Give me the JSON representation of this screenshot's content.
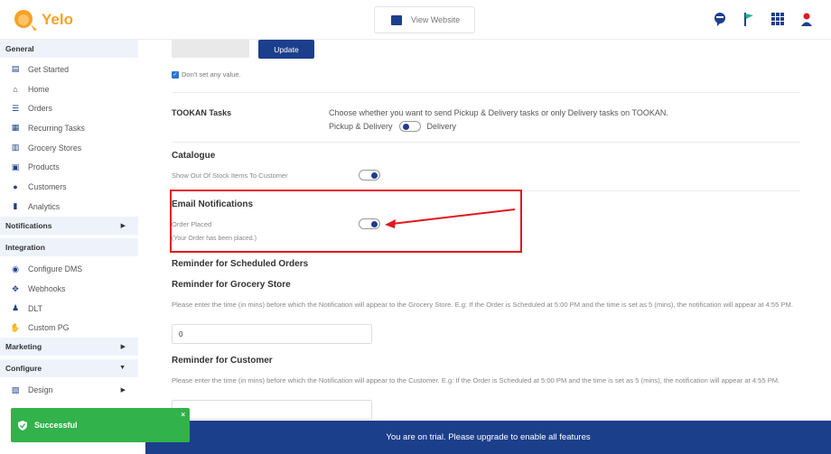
{
  "brand": {
    "name": "Yelo",
    "color": "#f7a325"
  },
  "header": {
    "view_website": "View Website",
    "icons": [
      "support-chat-icon",
      "flag-icon",
      "apps-grid-icon",
      "user-avatar-icon"
    ]
  },
  "sidebar": {
    "general": "General",
    "items": [
      {
        "label": "Get Started",
        "icon": "clipboard-icon"
      },
      {
        "label": "Home",
        "icon": "home-icon"
      },
      {
        "label": "Orders",
        "icon": "orders-icon"
      },
      {
        "label": "Recurring Tasks",
        "icon": "calendar-icon"
      },
      {
        "label": "Grocery Stores",
        "icon": "store-icon"
      },
      {
        "label": "Products",
        "icon": "products-icon"
      },
      {
        "label": "Customers",
        "icon": "customers-icon"
      },
      {
        "label": "Analytics",
        "icon": "analytics-icon"
      }
    ],
    "notifications": "Notifications",
    "integration": "Integration",
    "integration_items": [
      {
        "label": "Configure DMS",
        "icon": "dms-icon"
      },
      {
        "label": "Webhooks",
        "icon": "webhooks-icon"
      },
      {
        "label": "DLT",
        "icon": "dlt-icon"
      },
      {
        "label": "Custom PG",
        "icon": "payment-icon"
      }
    ],
    "marketing": "Marketing",
    "configure": "Configure",
    "configure_items": [
      {
        "label": "Design",
        "icon": "design-icon"
      }
    ]
  },
  "main": {
    "update_label": "Update",
    "dont_set": "Don't set any value.",
    "tookan": {
      "label": "TOOKAN Tasks",
      "desc": "Choose whether you want to send Pickup & Delivery tasks or only Delivery tasks on TOOKAN.",
      "left": "Pickup & Delivery",
      "right": "Delivery"
    },
    "catalogue": {
      "title": "Catalogue",
      "show_out_of_stock": "Show Out Of Stock Items To Customer"
    },
    "email": {
      "title": "Email Notifications",
      "order_placed": "Order Placed",
      "order_placed_sub": "(Your Order has been placed.)"
    },
    "reminder": {
      "title": "Reminder for Scheduled Orders",
      "grocery_title": "Reminder for Grocery Store",
      "grocery_desc": "Please enter the time (in mins) before which the Notification will appear to the Grocery Store. E.g: If the Order is Scheduled at 5:00 PM and the time is set as 5 (mins), the notification will appear at 4:55 PM.",
      "grocery_value": "0",
      "customer_title": "Reminder for Customer",
      "customer_desc": "Please enter the time (in mins) before which the Notification will appear to the Customer. E.g: If the Order is Scheduled at 5:00 PM and the time is set as 5 (mins), the notification will appear at 4:55 PM."
    }
  },
  "trial": "You are on trial. Please upgrade to enable all features",
  "toast": {
    "text": "Successful",
    "close": "×",
    "color": "#31b24a"
  },
  "colors": {
    "primary": "#1c3f8c",
    "highlight": "#e4161e"
  }
}
